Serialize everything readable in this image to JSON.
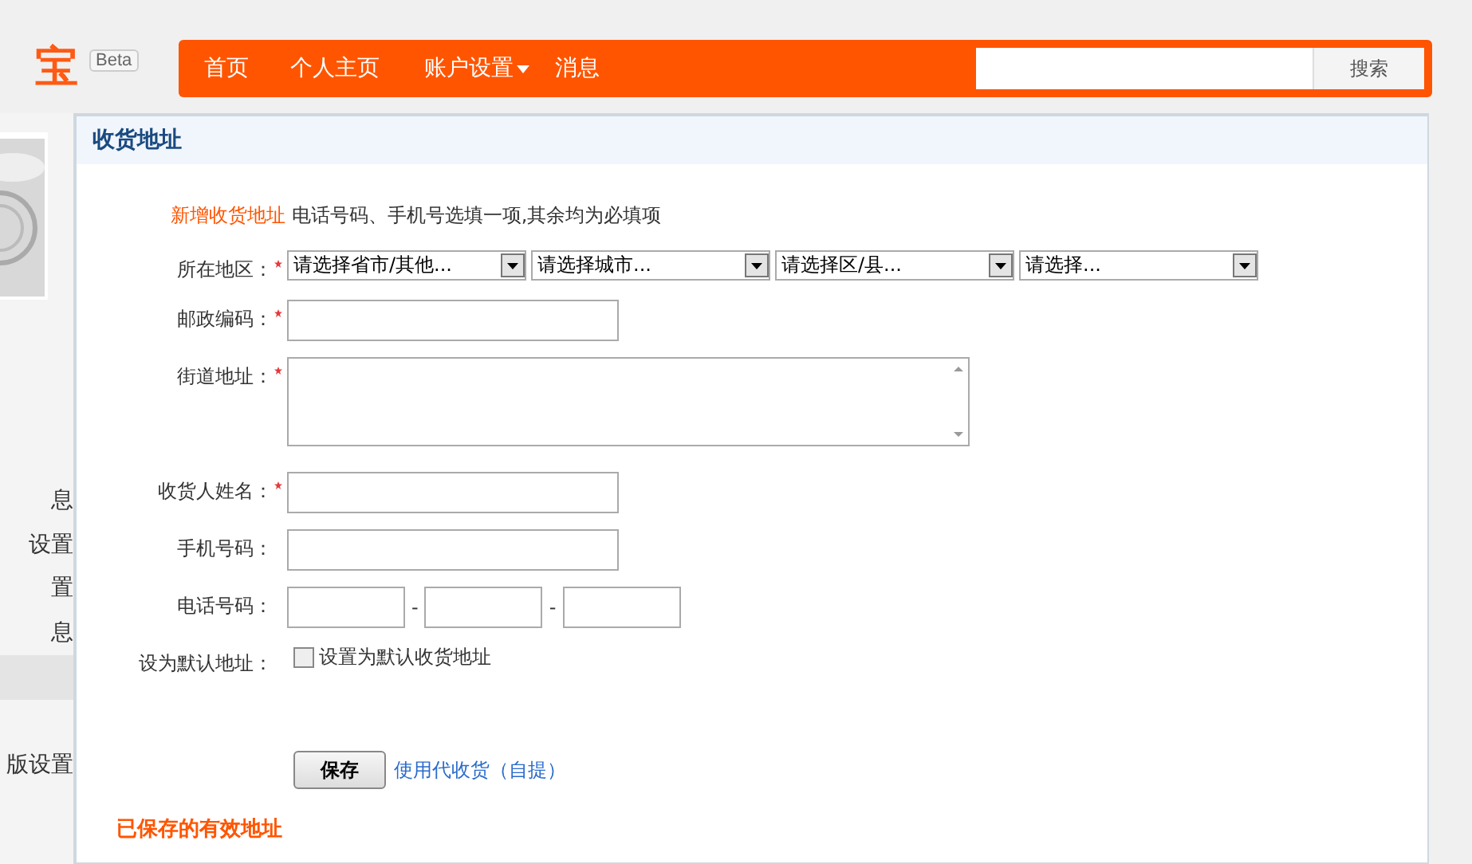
{
  "logo": {
    "text": "宝",
    "badge": "Beta"
  },
  "nav": {
    "items": [
      {
        "label": "首页",
        "dropdown": false
      },
      {
        "label": "个人主页",
        "dropdown": false
      },
      {
        "label": "账户设置",
        "dropdown": true
      },
      {
        "label": "消息",
        "dropdown": false
      }
    ],
    "search": {
      "button": "搜索"
    }
  },
  "sidebar": {
    "items": [
      {
        "label": "息",
        "selected": false
      },
      {
        "label": "设置",
        "selected": false
      },
      {
        "label": "置",
        "selected": false
      },
      {
        "label": "息",
        "selected": false
      },
      {
        "selected": true
      },
      {
        "label": "版设置",
        "selected": false
      }
    ]
  },
  "panel": {
    "title": "收货地址",
    "intro": {
      "title": "新增收货地址",
      "note": "电话号码、手机号选填一项,其余均为必填项"
    },
    "fields": [
      {
        "kind": "selects",
        "label": "所在地区：",
        "required": true,
        "options": [
          "请选择省市/其他...",
          "请选择城市...",
          "请选择区/县...",
          "请选择..."
        ]
      },
      {
        "kind": "text",
        "label": "邮政编码：",
        "required": true
      },
      {
        "kind": "textarea",
        "label": "街道地址：",
        "required": true
      },
      {
        "kind": "text",
        "label": "收货人姓名：",
        "required": true
      },
      {
        "kind": "text",
        "label": "手机号码：",
        "required": false
      },
      {
        "kind": "phone",
        "label": "电话号码：",
        "required": false,
        "separators": [
          "-",
          "-"
        ]
      },
      {
        "kind": "checkbox",
        "label": "设为默认地址：",
        "required": false,
        "checked": false,
        "text": "设置为默认收货地址"
      }
    ],
    "save": "保存",
    "link": "使用代收货（自提）",
    "saved_title": "已保存的有效地址"
  }
}
